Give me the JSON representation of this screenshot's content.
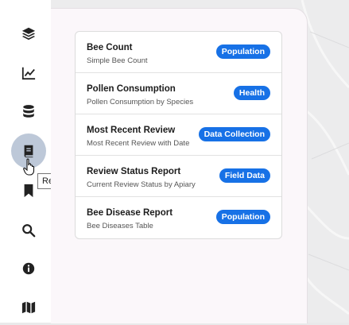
{
  "colors": {
    "badge": "#1771e6",
    "active_nav": "#bdc8d8",
    "icon": "#222222"
  },
  "sidebar": {
    "items": [
      {
        "icon": "layers-icon",
        "active": false
      },
      {
        "icon": "line-chart-icon",
        "active": false
      },
      {
        "icon": "database-icon",
        "active": false
      },
      {
        "icon": "book-icon",
        "active": true
      },
      {
        "icon": "bookmark-icon",
        "active": false
      },
      {
        "icon": "search-icon",
        "active": false
      },
      {
        "icon": "info-icon",
        "active": false
      },
      {
        "icon": "map-icon",
        "active": false
      }
    ],
    "tooltip": "Reports"
  },
  "reports": [
    {
      "title": "Bee Count",
      "description": "Simple Bee Count",
      "badge": "Population"
    },
    {
      "title": "Pollen Consumption",
      "description": "Pollen Consumption by Species",
      "badge": "Health"
    },
    {
      "title": "Most Recent Review",
      "description": "Most Recent Review with Date",
      "badge": "Data Collection"
    },
    {
      "title": "Review Status Report",
      "description": "Current Review Status by Apiary",
      "badge": "Field Data"
    },
    {
      "title": "Bee Disease Report",
      "description": "Bee Diseases Table",
      "badge": "Population"
    }
  ]
}
